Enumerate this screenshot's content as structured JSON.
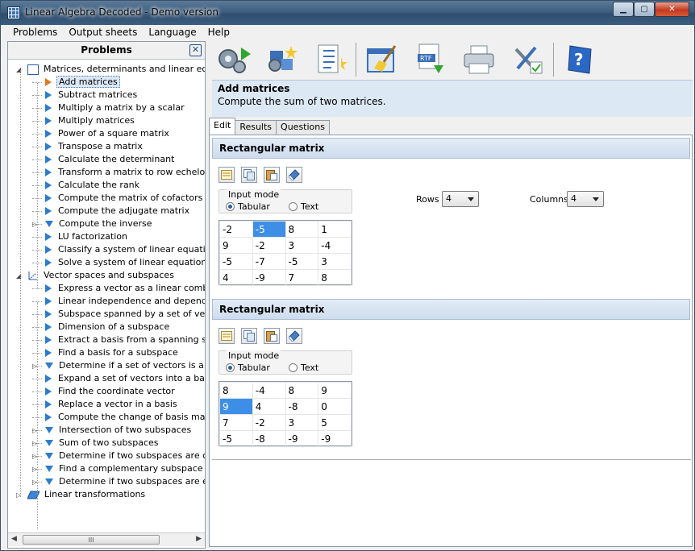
{
  "window": {
    "title": "Linear Algebra Decoded - Demo version"
  },
  "menu": [
    "Problems",
    "Output sheets",
    "Language",
    "Help"
  ],
  "left_panel": {
    "title": "Problems"
  },
  "tree": [
    {
      "label": "Matrices, determinants and linear equatio",
      "level": 0,
      "kind": "group",
      "expanded": true
    },
    {
      "label": "Add matrices",
      "level": 1,
      "kind": "leaf",
      "selected": true
    },
    {
      "label": "Subtract matrices",
      "level": 1,
      "kind": "leaf"
    },
    {
      "label": "Multiply a matrix by a scalar",
      "level": 1,
      "kind": "leaf"
    },
    {
      "label": "Multiply matrices",
      "level": 1,
      "kind": "leaf"
    },
    {
      "label": "Power of a square matrix",
      "level": 1,
      "kind": "leaf"
    },
    {
      "label": "Transpose a matrix",
      "level": 1,
      "kind": "leaf"
    },
    {
      "label": "Calculate the determinant",
      "level": 1,
      "kind": "leaf"
    },
    {
      "label": "Transform a matrix to row echelon for",
      "level": 1,
      "kind": "leaf"
    },
    {
      "label": "Calculate the rank",
      "level": 1,
      "kind": "leaf"
    },
    {
      "label": "Compute the matrix of cofactors",
      "level": 1,
      "kind": "leaf"
    },
    {
      "label": "Compute the adjugate matrix",
      "level": 1,
      "kind": "leaf"
    },
    {
      "label": "Compute the inverse",
      "level": 1,
      "kind": "folder"
    },
    {
      "label": "LU factorization",
      "level": 1,
      "kind": "leaf"
    },
    {
      "label": "Classify a system of linear equations",
      "level": 1,
      "kind": "leaf"
    },
    {
      "label": "Solve a system of linear equations",
      "level": 1,
      "kind": "leaf"
    },
    {
      "label": "Vector spaces and subspaces",
      "level": 0,
      "kind": "group2",
      "expanded": true
    },
    {
      "label": "Express a vector as a linear combinat",
      "level": 1,
      "kind": "leaf"
    },
    {
      "label": "Linear independence and dependence",
      "level": 1,
      "kind": "leaf"
    },
    {
      "label": "Subspace spanned by a set of vector",
      "level": 1,
      "kind": "leaf"
    },
    {
      "label": "Dimension of a subspace",
      "level": 1,
      "kind": "leaf"
    },
    {
      "label": "Extract a basis from a spanning set",
      "level": 1,
      "kind": "leaf"
    },
    {
      "label": "Find a basis for a subspace",
      "level": 1,
      "kind": "leaf"
    },
    {
      "label": "Determine if a set of vectors is a basi",
      "level": 1,
      "kind": "folder"
    },
    {
      "label": "Expand a set of vectors into a basis",
      "level": 1,
      "kind": "leaf"
    },
    {
      "label": "Find the coordinate vector",
      "level": 1,
      "kind": "leaf"
    },
    {
      "label": "Replace a vector in a basis",
      "level": 1,
      "kind": "leaf"
    },
    {
      "label": "Compute the change of basis matrix",
      "level": 1,
      "kind": "leaf"
    },
    {
      "label": "Intersection of two subspaces",
      "level": 1,
      "kind": "folder"
    },
    {
      "label": "Sum of two subspaces",
      "level": 1,
      "kind": "folder"
    },
    {
      "label": "Determine if two subspaces are comp",
      "level": 1,
      "kind": "folder"
    },
    {
      "label": "Find a complementary subspace",
      "level": 1,
      "kind": "folder"
    },
    {
      "label": "Determine if two subspaces are equal",
      "level": 1,
      "kind": "folder"
    },
    {
      "label": "Linear transformations",
      "level": 0,
      "kind": "group3",
      "expanded": false
    }
  ],
  "hscroll_thumb": "III",
  "description": {
    "title": "Add matrices",
    "text": "Compute the sum of two matrices."
  },
  "tabs": [
    "Edit",
    "Results",
    "Questions"
  ],
  "matrix_blocks": [
    {
      "title": "Rectangular matrix",
      "input_mode_label": "Input mode",
      "tabular_label": "Tabular",
      "text_label": "Text",
      "rows_label": "Rows",
      "rows": "4",
      "columns_label": "Columns",
      "columns": "4",
      "cells": [
        [
          "-2",
          "-5",
          "8",
          "1"
        ],
        [
          "9",
          "-2",
          "3",
          "-4"
        ],
        [
          "-5",
          "-7",
          "-5",
          "3"
        ],
        [
          "4",
          "-9",
          "7",
          "8"
        ]
      ],
      "highlight": [
        0,
        1
      ],
      "show_dims": true
    },
    {
      "title": "Rectangular matrix",
      "input_mode_label": "Input mode",
      "tabular_label": "Tabular",
      "text_label": "Text",
      "cells": [
        [
          "8",
          "-4",
          "8",
          "9"
        ],
        [
          "9",
          "4",
          "-8",
          "0"
        ],
        [
          "7",
          "-2",
          "3",
          "5"
        ],
        [
          "-5",
          "-8",
          "-9",
          "-9"
        ]
      ],
      "highlight": [
        1,
        0
      ],
      "show_dims": false
    }
  ],
  "colors": {
    "accent": "#2b7bd0",
    "selection": "#3d8ee6",
    "header_bg": "#dce8f3"
  }
}
